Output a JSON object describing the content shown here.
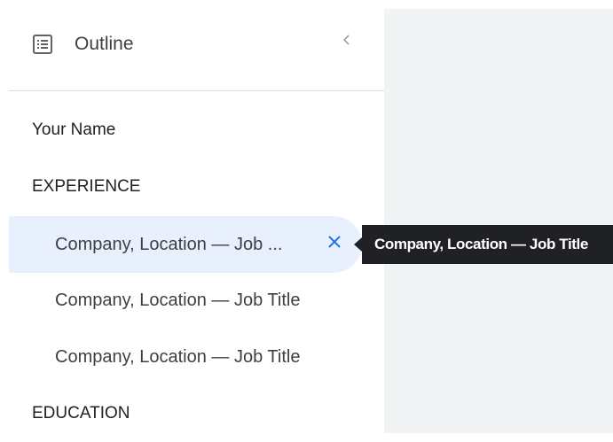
{
  "outline": {
    "title": "Outline",
    "icon": "outline-list-icon",
    "collapse_icon": "chevron-left-icon"
  },
  "items": [
    {
      "label": "Your Name",
      "level": 1
    },
    {
      "label": "EXPERIENCE",
      "level": 1
    },
    {
      "label": "Company, Location — Job ...",
      "level": 2,
      "selected": true
    },
    {
      "label": "Company, Location — Job Title",
      "level": 2
    },
    {
      "label": "Company, Location — Job Title",
      "level": 2
    },
    {
      "label": "EDUCATION",
      "level": 1
    }
  ],
  "selected_item": {
    "remove_icon": "close-icon"
  },
  "tooltip": {
    "text": "Company, Location — Job Title"
  },
  "colors": {
    "accent": "#1a73e8",
    "selected_background": "#e8f0fe",
    "content_background": "#f1f3f4",
    "tooltip_background": "#202124",
    "divider": "#dadce0"
  }
}
